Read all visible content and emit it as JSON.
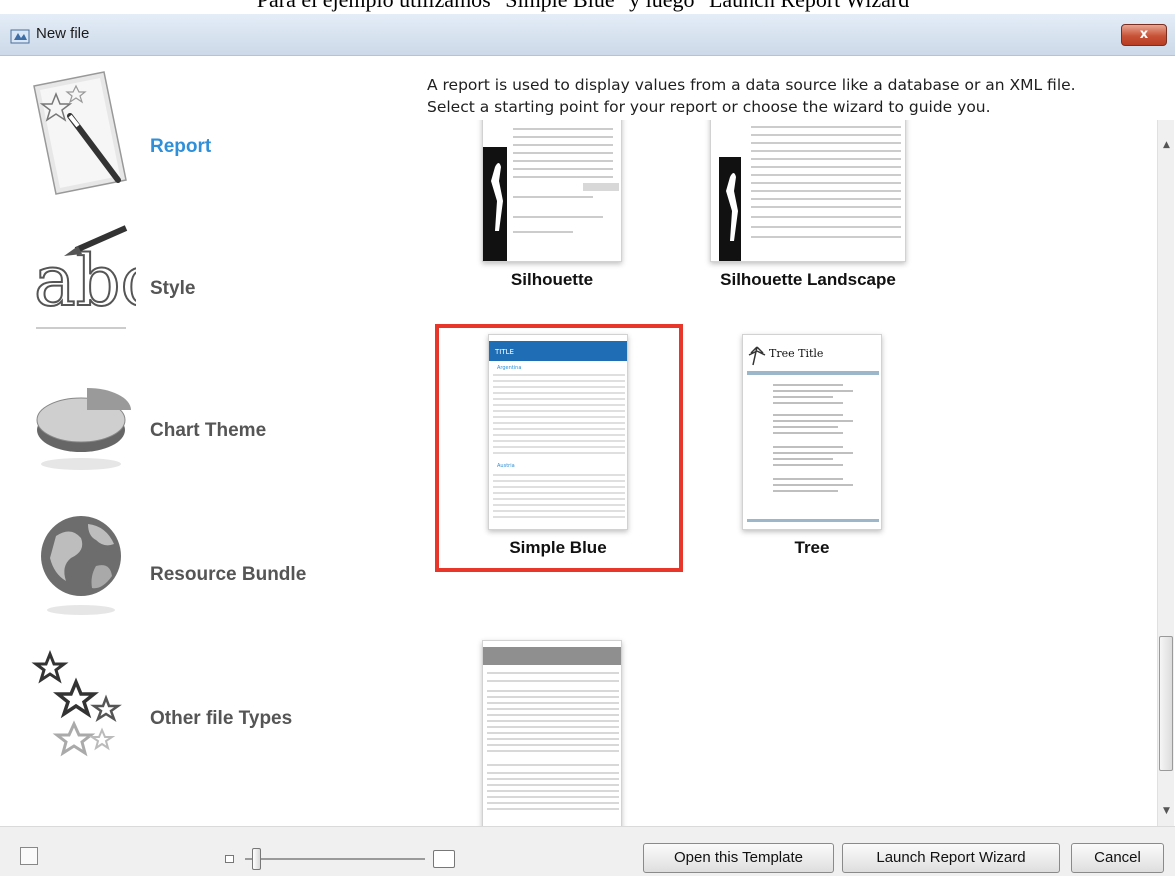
{
  "caption": "Para el ejemplo utilizamos \"Simple Blue\" y luego \"Launch Report Wizard\"",
  "window": {
    "title": "New file",
    "close_label": "x"
  },
  "sidebar": {
    "items": [
      {
        "label": "Report",
        "icon": "report-icon",
        "active": true
      },
      {
        "label": "Style",
        "icon": "style-icon",
        "active": false
      },
      {
        "label": "Chart Theme",
        "icon": "chart-theme-icon",
        "active": false
      },
      {
        "label": "Resource Bundle",
        "icon": "globe-icon",
        "active": false
      },
      {
        "label": "Other file Types",
        "icon": "stars-icon",
        "active": false
      }
    ]
  },
  "description": {
    "line1": "A report is used to display values from a data source like a database or an XML file.",
    "line2": "Select a starting point for your report or choose the wizard to guide you."
  },
  "templates": [
    {
      "label": "Silhouette"
    },
    {
      "label": "Silhouette Landscape"
    },
    {
      "label": "Simple Blue",
      "selected": true,
      "thumb_title": "TITLE"
    },
    {
      "label": "Tree",
      "thumb_title": "Tree Title"
    },
    {
      "label": "",
      "thumb_title": ""
    }
  ],
  "buttons": {
    "open_template": "Open this Template",
    "launch_wizard": "Launch Report Wizard",
    "cancel": "Cancel"
  },
  "colors": {
    "accent": "#2f8fd8",
    "selection": "#e8362b",
    "close": "#c75237"
  }
}
